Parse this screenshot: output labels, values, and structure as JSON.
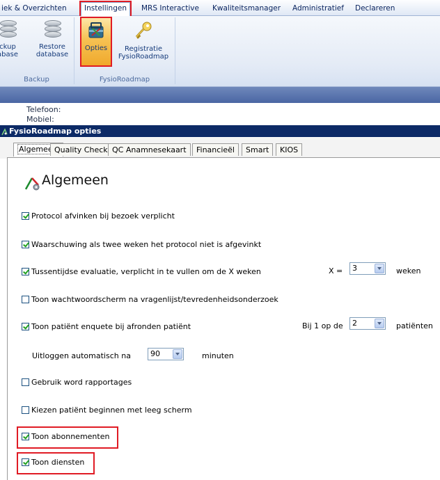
{
  "ribbon": {
    "tabs": [
      "iek & Overzichten",
      "Instellingen",
      "MRS Interactive",
      "Kwaliteitsmanager",
      "Administratief",
      "Declareren"
    ],
    "buttons": {
      "backup": [
        "ckup",
        "abase"
      ],
      "restore": [
        "Restore",
        "database"
      ],
      "opties": "Opties",
      "registratie": [
        "Registratie",
        "FysioRoadmap"
      ]
    },
    "groups": {
      "backup": "Backup",
      "fysioroadmap": "FysioRoadmap"
    }
  },
  "contact": {
    "telefoon": "Telefoon:",
    "mobiel": "Mobiel:"
  },
  "dialog": {
    "title": "FysioRoadmap opties",
    "tabs": [
      "Algemeen",
      "Quality Check",
      "QC Anamnesekaart",
      "Financieël",
      "Smart",
      "KIOS"
    ],
    "heading": "Algemeen"
  },
  "options": {
    "protocol": {
      "label": "Protocol afvinken bij bezoek verplicht",
      "checked": true
    },
    "waarschuwing": {
      "label": "Waarschuwing als twee weken het protocol niet is afgevinkt",
      "checked": true
    },
    "tussentijds": {
      "label": "Tussentijdse evaluatie, verplicht in te vullen om de X weken",
      "checked": true,
      "x_label": "X =",
      "x_value": "3",
      "unit": "weken"
    },
    "wachtwoord": {
      "label": "Toon wachtwoordscherm na vragenlijst/tevredenheidsonderzoek",
      "checked": false
    },
    "enquete": {
      "label": "Toon patiënt enquete bij afronden patiënt",
      "checked": true,
      "prefix": "Bij 1 op de",
      "value": "2",
      "unit": "patiënten"
    },
    "uitloggen": {
      "label": "Uitloggen automatisch na",
      "value": "90",
      "unit": "minuten"
    },
    "word": {
      "label": "Gebruik word rapportages",
      "checked": false
    },
    "leeg": {
      "label": "Kiezen patiënt beginnen met leeg scherm",
      "checked": false
    },
    "abonnementen": {
      "label": "Toon abonnementen",
      "checked": true
    },
    "diensten": {
      "label": "Toon diensten",
      "checked": true
    }
  },
  "colors": {
    "highlight": "#e01b24",
    "title_bar": "#0c2a66",
    "check": "#21a121"
  }
}
